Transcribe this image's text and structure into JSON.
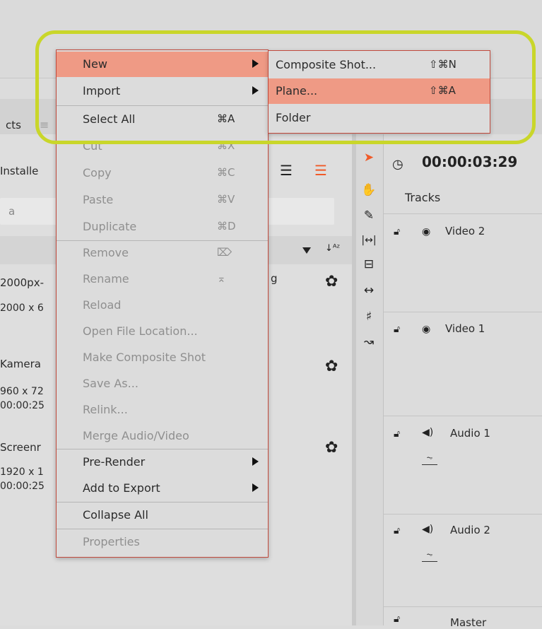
{
  "left_panel": {
    "tab_label": "cts",
    "installed_label": "Installe",
    "search_text": "a",
    "items": [
      {
        "name": "2000px-",
        "detail": "2000 x 6",
        "extra": ""
      },
      {
        "name": "Kamera",
        "detail": "960 x 72",
        "extra": "00:00:25"
      },
      {
        "name": "Screenr",
        "detail": "1920 x 1",
        "extra": "00:00:25"
      }
    ],
    "stray_char": "g"
  },
  "timeline": {
    "timecode": "00:00:03:29",
    "tracks_header": "Tracks",
    "tracks": [
      {
        "name": "Video 2",
        "kind": "video"
      },
      {
        "name": "Video 1",
        "kind": "video"
      },
      {
        "name": "Audio 1",
        "kind": "audio"
      },
      {
        "name": "Audio 2",
        "kind": "audio"
      },
      {
        "name": "Master",
        "kind": "master"
      }
    ]
  },
  "context_menu": {
    "items": [
      {
        "label": "New",
        "shortcut": "",
        "submenu": true,
        "enabled": true,
        "highlighted": true
      },
      {
        "label": "Import",
        "shortcut": "",
        "submenu": true,
        "enabled": true,
        "highlighted": false
      },
      {
        "label": "Select All",
        "shortcut": "⌘A",
        "submenu": false,
        "enabled": true,
        "highlighted": false
      },
      {
        "label": "Cut",
        "shortcut": "⌘X",
        "submenu": false,
        "enabled": false,
        "highlighted": false
      },
      {
        "label": "Copy",
        "shortcut": "⌘C",
        "submenu": false,
        "enabled": false,
        "highlighted": false
      },
      {
        "label": "Paste",
        "shortcut": "⌘V",
        "submenu": false,
        "enabled": false,
        "highlighted": false
      },
      {
        "label": "Duplicate",
        "shortcut": "⌘D",
        "submenu": false,
        "enabled": false,
        "highlighted": false
      },
      {
        "label": "Remove",
        "shortcut": "⌦",
        "submenu": false,
        "enabled": false,
        "highlighted": false
      },
      {
        "label": "Rename",
        "shortcut": "⌅",
        "submenu": false,
        "enabled": false,
        "highlighted": false
      },
      {
        "label": "Reload",
        "shortcut": "",
        "submenu": false,
        "enabled": false,
        "highlighted": false
      },
      {
        "label": "Open File Location...",
        "shortcut": "",
        "submenu": false,
        "enabled": false,
        "highlighted": false
      },
      {
        "label": "Make Composite Shot",
        "shortcut": "",
        "submenu": false,
        "enabled": false,
        "highlighted": false
      },
      {
        "label": "Save As...",
        "shortcut": "",
        "submenu": false,
        "enabled": false,
        "highlighted": false
      },
      {
        "label": "Relink...",
        "shortcut": "",
        "submenu": false,
        "enabled": false,
        "highlighted": false
      },
      {
        "label": "Merge Audio/Video",
        "shortcut": "",
        "submenu": false,
        "enabled": false,
        "highlighted": false
      },
      {
        "label": "Pre-Render",
        "shortcut": "",
        "submenu": true,
        "enabled": true,
        "highlighted": false
      },
      {
        "label": "Add to Export",
        "shortcut": "",
        "submenu": true,
        "enabled": true,
        "highlighted": false
      },
      {
        "label": "Collapse All",
        "shortcut": "",
        "submenu": false,
        "enabled": true,
        "highlighted": false
      },
      {
        "label": "Properties",
        "shortcut": "",
        "submenu": false,
        "enabled": false,
        "highlighted": false
      }
    ]
  },
  "submenu_new": {
    "items": [
      {
        "label": "Composite Shot...",
        "shortcut": "⇧⌘N",
        "highlighted": false
      },
      {
        "label": "Plane...",
        "shortcut": "⇧⌘A",
        "highlighted": true
      },
      {
        "label": "Folder",
        "shortcut": "",
        "highlighted": false
      }
    ]
  },
  "colors": {
    "menu_highlight": "#ef9a85",
    "menu_border": "#c14a3d",
    "annotation_outline": "#c9d62a",
    "accent_orange": "#f05a28"
  },
  "icons": {
    "tools": [
      "pointer-icon",
      "hand-icon",
      "razor-icon",
      "fit-width-icon",
      "split-icon",
      "stretch-icon",
      "slip-icon",
      "curve-icon"
    ]
  }
}
